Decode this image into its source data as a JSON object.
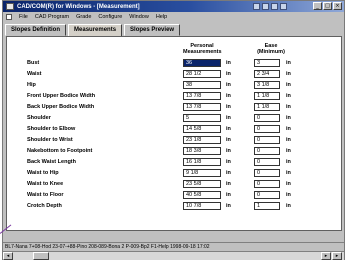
{
  "window": {
    "title": "CAD/COM(R) for Windows - [Measurement]"
  },
  "menubar": {
    "items": [
      "File",
      "CAD Program",
      "Grade",
      "Configure",
      "Window",
      "Help"
    ]
  },
  "tabs": [
    {
      "label": "Slopes Definition",
      "active": false
    },
    {
      "label": "Measurements",
      "active": true
    },
    {
      "label": "Slopes Preview",
      "active": false
    }
  ],
  "columns": {
    "personal": "Personal\nMeasurements",
    "ease": "Ease\n(Minimum)"
  },
  "rows": [
    {
      "label": "Bust",
      "personal": "36",
      "personal_selected": true,
      "unit1": "in",
      "ease": "3",
      "unit2": "in"
    },
    {
      "label": "Waist",
      "personal": "28 1/2",
      "unit1": "in",
      "ease": "2 3/4",
      "unit2": "in"
    },
    {
      "label": "Hip",
      "personal": "38",
      "unit1": "in",
      "ease": "3 1/8",
      "unit2": "in"
    },
    {
      "label": "Front Upper Bodice Width",
      "personal": "13 7/8",
      "unit1": "in",
      "ease": "1 1/8",
      "unit2": "in"
    },
    {
      "label": "Back Upper Bodice Width",
      "personal": "13 7/8",
      "unit1": "in",
      "ease": "1 1/8",
      "unit2": "in"
    },
    {
      "label": "Shoulder",
      "personal": "5",
      "unit1": "in",
      "ease": "0",
      "unit2": "in"
    },
    {
      "label": "Shoulder to Elbow",
      "personal": "14 5/8",
      "unit1": "in",
      "ease": "0",
      "unit2": "in"
    },
    {
      "label": "Shoulder to Wrist",
      "personal": "23 1/8",
      "unit1": "in",
      "ease": "0",
      "unit2": "in"
    },
    {
      "label": "Nakebottom to Footpoint",
      "personal": "18 3/8",
      "unit1": "in",
      "ease": "0",
      "unit2": "in"
    },
    {
      "label": "Back Waist Length",
      "personal": "16 1/8",
      "unit1": "in",
      "ease": "0",
      "unit2": "in"
    },
    {
      "label": "Waist to Hip",
      "personal": "9 1/8",
      "unit1": "in",
      "ease": "0",
      "unit2": "in"
    },
    {
      "label": "Waist to Knee",
      "personal": "23 5/8",
      "unit1": "in",
      "ease": "0",
      "unit2": "in"
    },
    {
      "label": "Waist to Floor",
      "personal": "40 5/8",
      "unit1": "in",
      "ease": "0",
      "unit2": "in"
    },
    {
      "label": "Crotch Depth",
      "personal": "10 7/8",
      "unit1": "in",
      "ease": "1",
      "unit2": "in"
    }
  ],
  "statusbar": {
    "text": "BL7-Nana  7+08-Hod  23-07-+88-Pino  208-089-Bona  2 P-009-Bp2  F1-Help  1998-09-18  17:02"
  },
  "icons": {
    "app": "app-icon",
    "minimize": "minimize-icon",
    "maximize": "maximize-icon",
    "close": "close-icon",
    "scroll_left": "scroll-left-icon",
    "scroll_right": "scroll-right-icon"
  }
}
